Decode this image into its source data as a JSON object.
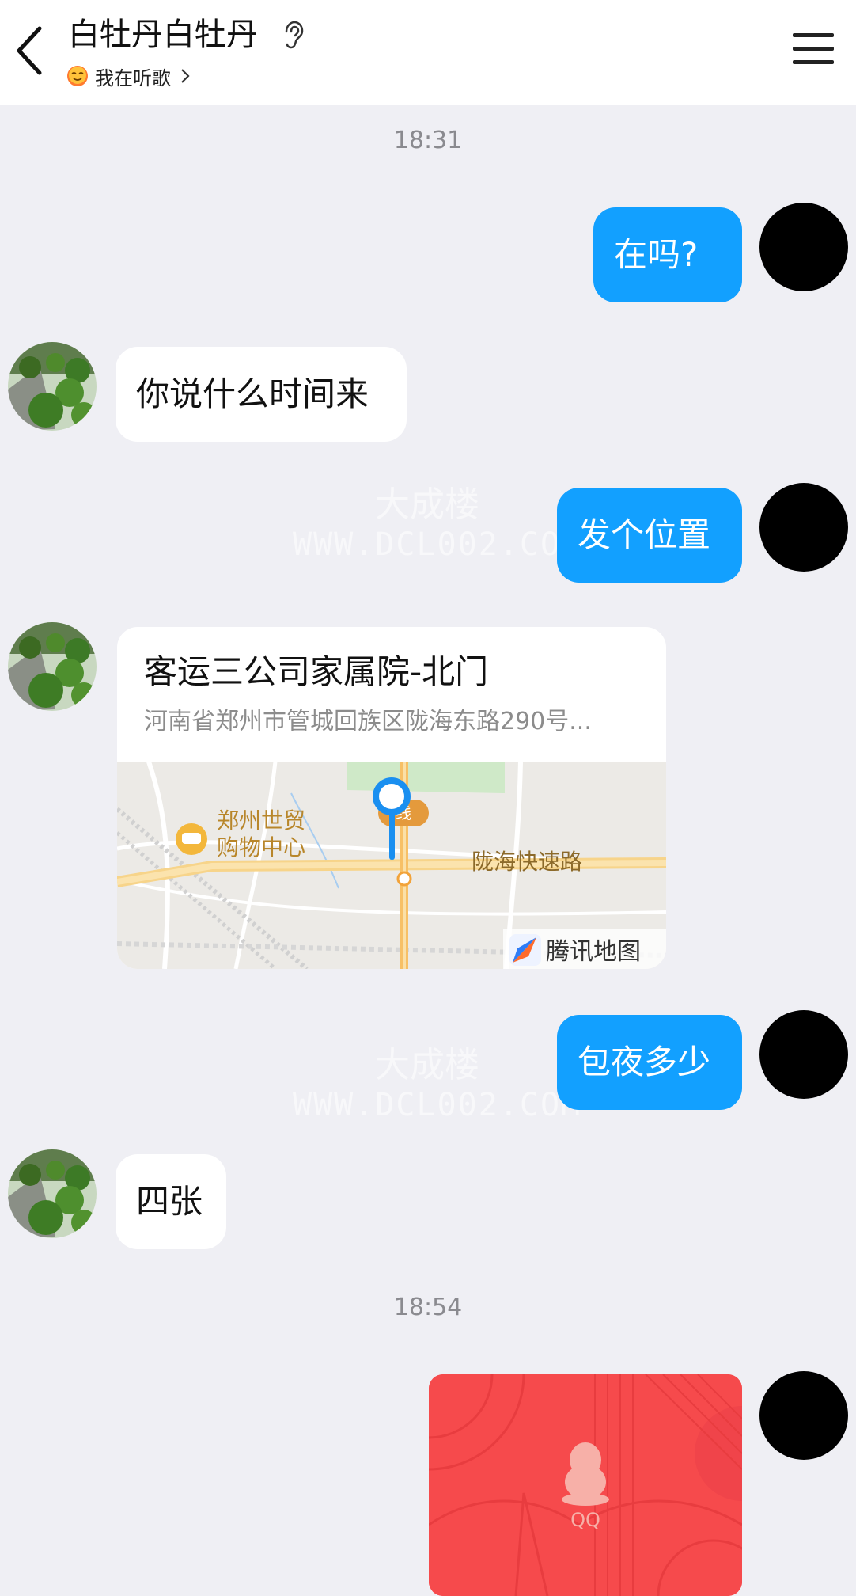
{
  "header": {
    "title": "白牡丹白牡丹",
    "status_text": "我在听歌"
  },
  "messages": {
    "time1": "18:31",
    "m1": "在吗?",
    "m2": "你说什么时间来",
    "m3": "发个位置",
    "location": {
      "title": "客运三公司家属院-北门",
      "address": "河南省郑州市管城回族区陇海东路290号...",
      "map_labels": {
        "poi_line1": "郑州世贸",
        "poi_line2": "购物中心",
        "road": "陇海快速路",
        "badge": "线",
        "brand": "腾讯地图"
      }
    },
    "m5": "包夜多少",
    "m6": "四张",
    "time2": "18:54",
    "redpacket_label": "QQ"
  },
  "watermark": {
    "line1": "大成楼",
    "line2": "WWW.DCL002.COM"
  },
  "colors": {
    "my_bubble": "#12a0ff",
    "page_bg": "#efeff4",
    "red_packet": "#f64a4c"
  },
  "icons": [
    "back-arrow-icon",
    "ear-icon",
    "music-emoji-icon",
    "chevron-right-icon",
    "menu-icon",
    "map-pin-icon",
    "tencent-map-logo-icon",
    "qq-penguin-icon"
  ]
}
